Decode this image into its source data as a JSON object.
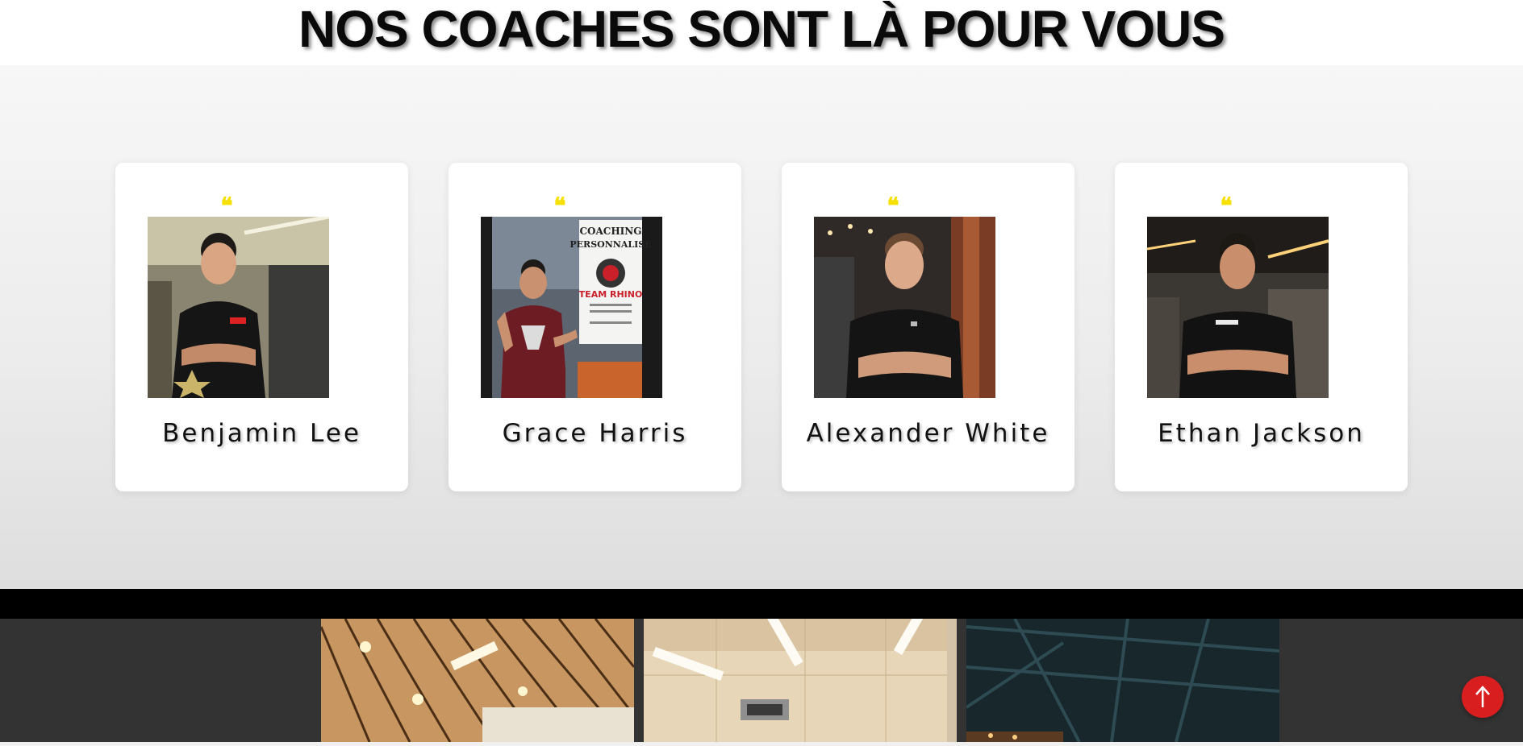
{
  "header": {
    "title": "NOS COACHES SONT LÀ POUR VOUS"
  },
  "coaches": [
    {
      "name": "Benjamin Lee",
      "quote_icon": "quote-icon"
    },
    {
      "name": "Grace Harris",
      "quote_icon": "quote-icon"
    },
    {
      "name": "Alexander White",
      "quote_icon": "quote-icon"
    },
    {
      "name": "Ethan Jackson",
      "quote_icon": "quote-icon"
    }
  ],
  "grace_photo_sign": {
    "line1": "COACHING",
    "line2": "PERSONNALISÉ",
    "brand": "TEAM RHINO"
  },
  "scroll_top": {
    "icon": "arrow-up-icon"
  },
  "colors": {
    "accent_quote": "#f5e000",
    "scroll_button": "#d81e1e",
    "gallery_bg": "#333333"
  }
}
